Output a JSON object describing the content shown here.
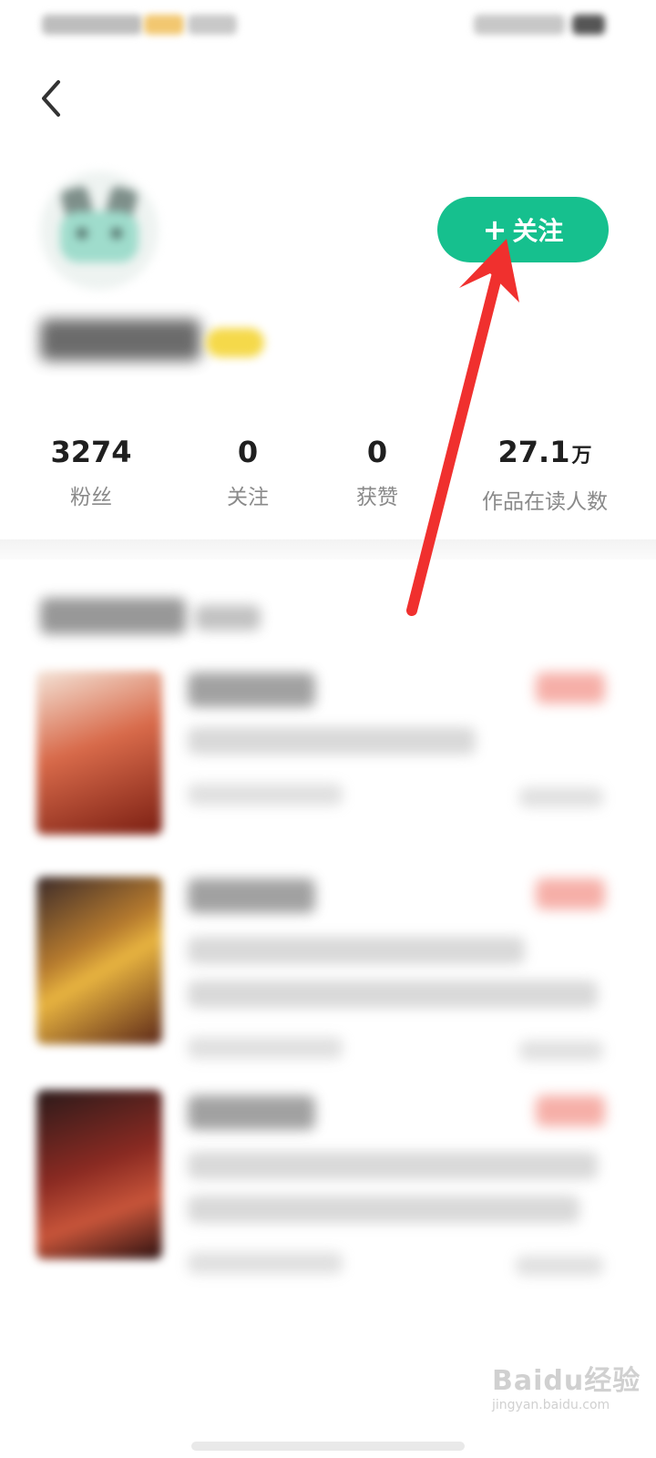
{
  "nav": {
    "back_icon": "chevron-left-icon"
  },
  "profile": {
    "avatar_icon": "avatar",
    "follow_button": {
      "plus": "+",
      "label": "关注",
      "color": "#16c08e"
    }
  },
  "stats": [
    {
      "value": "3274",
      "unit": "",
      "label": "粉丝"
    },
    {
      "value": "0",
      "unit": "",
      "label": "关注"
    },
    {
      "value": "0",
      "unit": "",
      "label": "获赞"
    },
    {
      "value": "27.1",
      "unit": "万",
      "label": "作品在读人数"
    }
  ],
  "annotation": {
    "color": "#f0302e"
  },
  "watermark": {
    "main": "Baidu经验",
    "sub": "jingyan.baidu.com"
  }
}
